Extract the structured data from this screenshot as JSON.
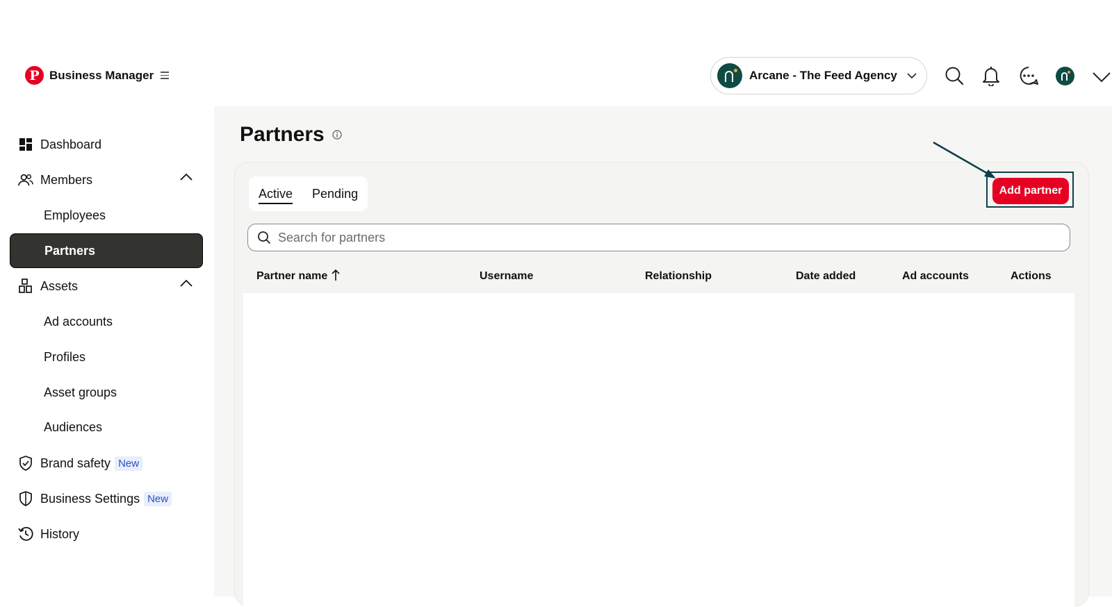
{
  "app": {
    "name": "Business Manager",
    "logo_letter": "P"
  },
  "header": {
    "account_name": "Arcane - The Feed Agency",
    "icons": [
      "search-icon",
      "bell-icon",
      "messages-icon",
      "user-avatar",
      "chevron-down-icon"
    ]
  },
  "sidebar": {
    "items": [
      {
        "label": "Dashboard",
        "icon": "dashboard-icon"
      },
      {
        "label": "Members",
        "icon": "members-icon",
        "expanded": true
      },
      {
        "label": "Employees"
      },
      {
        "label": "Partners",
        "active": true
      },
      {
        "label": "Assets",
        "icon": "assets-icon",
        "expanded": true
      },
      {
        "label": "Ad accounts"
      },
      {
        "label": "Profiles"
      },
      {
        "label": "Asset groups"
      },
      {
        "label": "Audiences"
      },
      {
        "label": "Brand safety",
        "icon": "shield-check-icon",
        "badge": "New"
      },
      {
        "label": "Business Settings",
        "icon": "shield-icon",
        "badge": "New"
      },
      {
        "label": "History",
        "icon": "history-icon"
      }
    ]
  },
  "main": {
    "title": "Partners",
    "tabs": [
      {
        "label": "Active",
        "selected": true
      },
      {
        "label": "Pending",
        "selected": false
      }
    ],
    "add_button": "Add partner",
    "search": {
      "placeholder": "Search for partners",
      "value": ""
    },
    "table": {
      "columns": [
        "Partner name",
        "Username",
        "Relationship",
        "Date added",
        "Ad accounts",
        "Actions"
      ],
      "sort_column": "Partner name",
      "sort_direction": "ascending",
      "rows": []
    }
  },
  "colors": {
    "brand_red": "#e60023",
    "active_nav": "#33332f",
    "avatar_teal": "#0f4b45",
    "annotation": "#0c3f4a",
    "badge_bg": "#e9eefc",
    "badge_text": "#2b4fc7"
  }
}
